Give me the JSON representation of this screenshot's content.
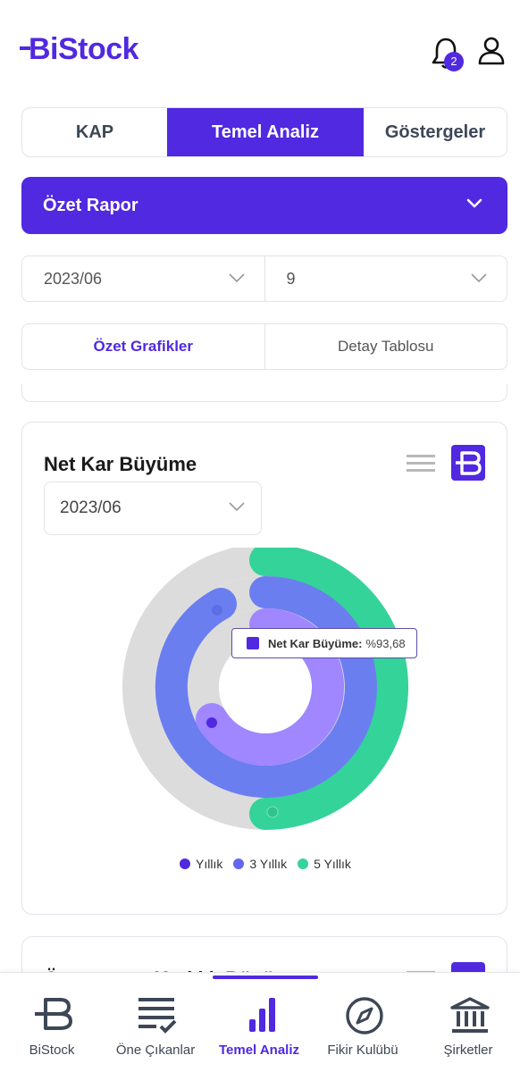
{
  "app": {
    "brand": "BiStock",
    "notification_count": "2"
  },
  "tabs": [
    "KAP",
    "Temel Analiz",
    "Göstergeler"
  ],
  "report_select": {
    "label": "Özet Rapor"
  },
  "period_select": {
    "value": "2023/06"
  },
  "count_select": {
    "value": "9"
  },
  "subtabs": [
    "Özet Grafikler",
    "Detay Tablosu"
  ],
  "card": {
    "title": "Net Kar Büyüme",
    "period": "2023/06",
    "tooltip": {
      "name": "Net Kar Büyüme:",
      "value": "%93,68"
    }
  },
  "chart_data": {
    "type": "radial-bar",
    "title": "Net Kar Büyüme",
    "series": [
      {
        "name": "Yıllık",
        "value": 93.68,
        "color": "#5029e0"
      },
      {
        "name": "3 Yıllık",
        "color": "#6366f1"
      },
      {
        "name": "5 Yıllık",
        "color": "#34d399"
      }
    ],
    "legend_position": "bottom"
  },
  "legend": [
    "Yıllık",
    "3 Yıllık",
    "5 Yıllık"
  ],
  "card2_title": "Özsermaye Karlılık Büyüme",
  "nav": [
    {
      "label": "BiStock",
      "icon": "bistock-logo-icon"
    },
    {
      "label": "Öne Çıkanlar",
      "icon": "list-check-icon"
    },
    {
      "label": "Temel Analiz",
      "icon": "bar-chart-icon"
    },
    {
      "label": "Fikir Kulübü",
      "icon": "compass-icon"
    },
    {
      "label": "Şirketler",
      "icon": "bank-icon"
    }
  ],
  "colors": {
    "accent": "#5029e0",
    "teal": "#34d399",
    "blue": "#6366f1",
    "grey_track": "#dcdcdc"
  }
}
